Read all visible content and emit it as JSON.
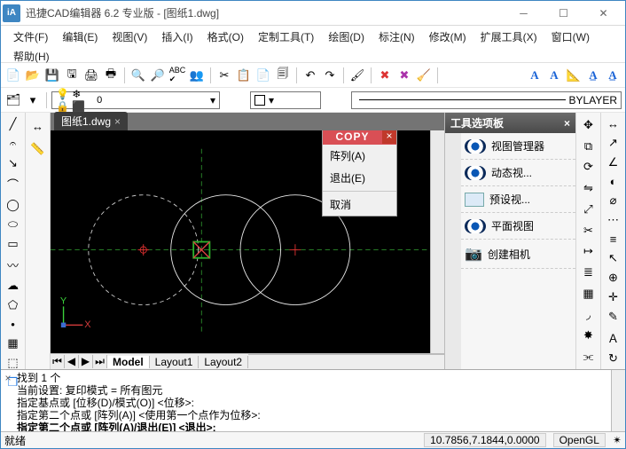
{
  "window": {
    "title": "迅捷CAD编辑器 6.2 专业版  - [图纸1.dwg]"
  },
  "menus": [
    "文件(F)",
    "编辑(E)",
    "视图(V)",
    "插入(I)",
    "格式(O)",
    "定制工具(T)",
    "绘图(D)",
    "标注(N)",
    "修改(M)",
    "扩展工具(X)",
    "窗口(W)",
    "帮助(H)"
  ],
  "layer": {
    "name": "0",
    "linetype": "BYLAYER",
    "lineweight": "BYLAYER"
  },
  "doc_tab": "图纸1.dwg",
  "ctx": {
    "title": "COPY",
    "items": [
      "阵列(A)",
      "退出(E)"
    ],
    "cancel": "取消"
  },
  "palette": {
    "title": "工具选项板",
    "items": [
      "视图管理器",
      "动态视...",
      "预设视...",
      "平面视图",
      "创建相机"
    ]
  },
  "bottom_tabs": {
    "model": "Model",
    "layouts": [
      "Layout1",
      "Layout2"
    ]
  },
  "cmd": {
    "history": "找到 1 个\n当前设置: 复印模式 = 所有图元\n指定基点或 [位移(D)/模式(O)] <位移>:\n指定第二个点或 [阵列(A)] <使用第一个点作为位移>:",
    "prompt": "指定第二个点或 [阵列(A)/退出(E)] <退出>:"
  },
  "status": {
    "ready": "就绪",
    "coords": "10.7856,7.1844,0.0000",
    "render": "OpenGL"
  }
}
